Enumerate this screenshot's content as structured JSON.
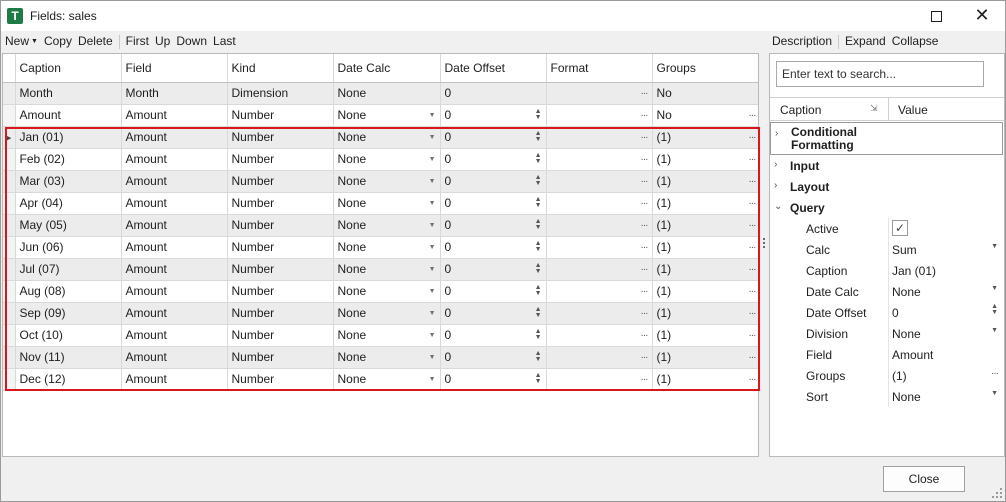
{
  "window": {
    "icon_letter": "T",
    "title": "Fields: sales"
  },
  "toolbar_left": {
    "new": "New",
    "copy": "Copy",
    "delete": "Delete",
    "first": "First",
    "up": "Up",
    "down": "Down",
    "last": "Last"
  },
  "toolbar_right": {
    "description": "Description",
    "expand": "Expand",
    "collapse": "Collapse"
  },
  "grid": {
    "columns": [
      "Caption",
      "Field",
      "Kind",
      "Date Calc",
      "Date Offset",
      "Format",
      "Groups"
    ],
    "rows": [
      {
        "caption": "Month",
        "field": "Month",
        "kind": "Dimension",
        "date_calc": "None",
        "date_offset": "0",
        "groups": "No",
        "style": "group"
      },
      {
        "caption": "Amount",
        "field": "Amount",
        "kind": "Number",
        "date_calc": "None",
        "date_offset": "0",
        "groups": "No",
        "style": "normal"
      },
      {
        "caption": "Jan (01)",
        "field": "Amount",
        "kind": "Number",
        "date_calc": "None",
        "date_offset": "0",
        "groups": "(1)",
        "style": "group",
        "current": true
      },
      {
        "caption": "Feb (02)",
        "field": "Amount",
        "kind": "Number",
        "date_calc": "None",
        "date_offset": "0",
        "groups": "(1)",
        "style": "normal"
      },
      {
        "caption": "Mar (03)",
        "field": "Amount",
        "kind": "Number",
        "date_calc": "None",
        "date_offset": "0",
        "groups": "(1)",
        "style": "group"
      },
      {
        "caption": "Apr (04)",
        "field": "Amount",
        "kind": "Number",
        "date_calc": "None",
        "date_offset": "0",
        "groups": "(1)",
        "style": "normal"
      },
      {
        "caption": "May (05)",
        "field": "Amount",
        "kind": "Number",
        "date_calc": "None",
        "date_offset": "0",
        "groups": "(1)",
        "style": "group"
      },
      {
        "caption": "Jun (06)",
        "field": "Amount",
        "kind": "Number",
        "date_calc": "None",
        "date_offset": "0",
        "groups": "(1)",
        "style": "normal"
      },
      {
        "caption": "Jul (07)",
        "field": "Amount",
        "kind": "Number",
        "date_calc": "None",
        "date_offset": "0",
        "groups": "(1)",
        "style": "group"
      },
      {
        "caption": "Aug (08)",
        "field": "Amount",
        "kind": "Number",
        "date_calc": "None",
        "date_offset": "0",
        "groups": "(1)",
        "style": "normal"
      },
      {
        "caption": "Sep (09)",
        "field": "Amount",
        "kind": "Number",
        "date_calc": "None",
        "date_offset": "0",
        "groups": "(1)",
        "style": "group"
      },
      {
        "caption": "Oct (10)",
        "field": "Amount",
        "kind": "Number",
        "date_calc": "None",
        "date_offset": "0",
        "groups": "(1)",
        "style": "normal"
      },
      {
        "caption": "Nov (11)",
        "field": "Amount",
        "kind": "Number",
        "date_calc": "None",
        "date_offset": "0",
        "groups": "(1)",
        "style": "group"
      },
      {
        "caption": "Dec (12)",
        "field": "Amount",
        "kind": "Number",
        "date_calc": "None",
        "date_offset": "0",
        "groups": "(1)",
        "style": "normal"
      }
    ]
  },
  "properties": {
    "search_placeholder": "Enter text to search...",
    "header_caption": "Caption",
    "header_value": "Value",
    "categories": {
      "conditional_formatting": "Conditional Formatting",
      "input": "Input",
      "layout": "Layout",
      "query": "Query"
    },
    "query_props": [
      {
        "name": "Active",
        "value": "",
        "editor": "checkbox",
        "checked": true
      },
      {
        "name": "Calc",
        "value": "Sum",
        "editor": "dropdown"
      },
      {
        "name": "Caption",
        "value": "Jan (01)",
        "editor": "text"
      },
      {
        "name": "Date Calc",
        "value": "None",
        "editor": "dropdown"
      },
      {
        "name": "Date Offset",
        "value": "0",
        "editor": "spin"
      },
      {
        "name": "Division",
        "value": "None",
        "editor": "dropdown"
      },
      {
        "name": "Field",
        "value": "Amount",
        "editor": "text"
      },
      {
        "name": "Groups",
        "value": "(1)",
        "editor": "ellipsis"
      },
      {
        "name": "Sort",
        "value": "None",
        "editor": "dropdown"
      }
    ]
  },
  "footer": {
    "close_label": "Close"
  },
  "icons": {
    "app": "tables-app-icon",
    "maximize": "maximize-icon",
    "close": "close-icon"
  },
  "colors": {
    "app_icon": "#1e7b45",
    "selection_border": "#d9161c",
    "alt_row": "#ececec"
  }
}
